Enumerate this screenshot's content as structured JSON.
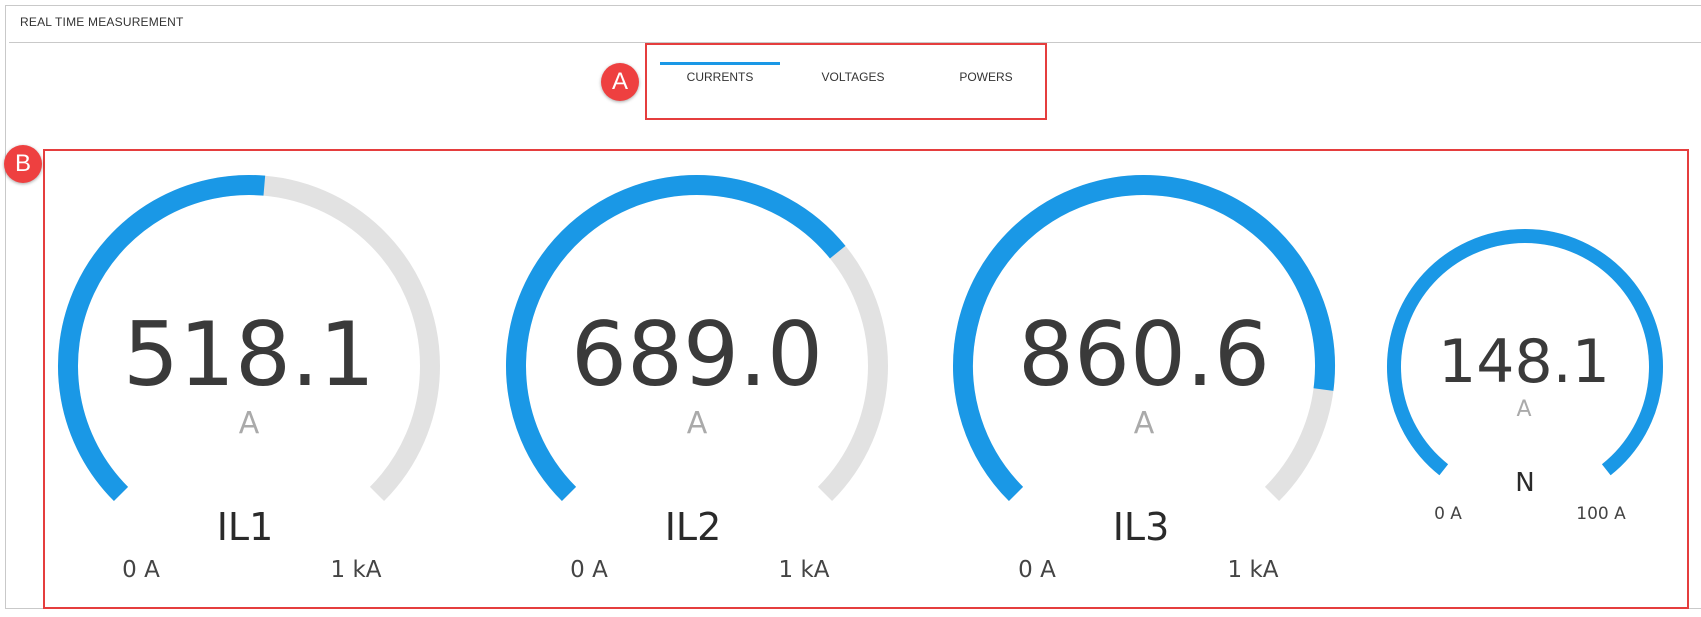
{
  "panel": {
    "title": "REAL TIME MEASUREMENT"
  },
  "tabs": [
    {
      "label": "CURRENTS",
      "active": true
    },
    {
      "label": "VOLTAGES",
      "active": false
    },
    {
      "label": "POWERS",
      "active": false
    }
  ],
  "annotations": [
    {
      "label": "A"
    },
    {
      "label": "B"
    }
  ],
  "colors": {
    "accent": "#1a98e6",
    "track": "#e2e2e2",
    "annotation": "#e53e3e"
  },
  "gauges": [
    {
      "label": "IL1",
      "value": "518.1",
      "unit": "A",
      "min_label": "0 A",
      "max_label": "1 kA",
      "fraction": 0.518
    },
    {
      "label": "IL2",
      "value": "689.0",
      "unit": "A",
      "min_label": "0 A",
      "max_label": "1 kA",
      "fraction": 0.689
    },
    {
      "label": "IL3",
      "value": "860.6",
      "unit": "A",
      "min_label": "0 A",
      "max_label": "1 kA",
      "fraction": 0.861
    },
    {
      "label": "N",
      "value": "148.1",
      "unit": "A",
      "min_label": "0 A",
      "max_label": "100 A",
      "fraction": 1.0
    }
  ]
}
